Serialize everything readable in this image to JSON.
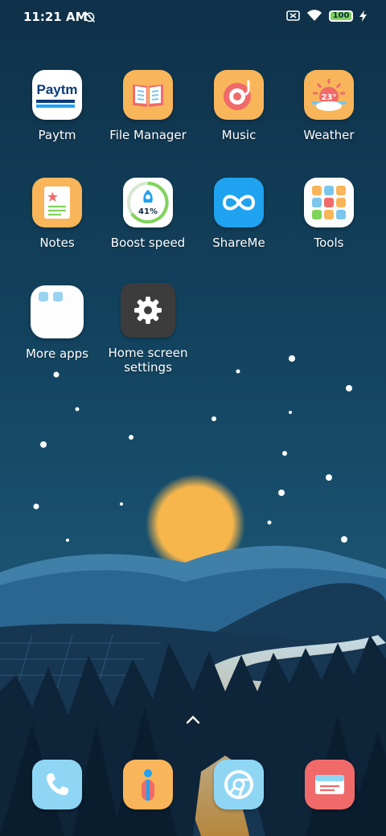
{
  "status_bar": {
    "time": "11:21 AM",
    "battery": "100",
    "icons": [
      "alarm-off-icon",
      "sim-off-icon",
      "wifi-icon",
      "battery-icon",
      "charging-icon"
    ]
  },
  "apps": [
    {
      "label": "Paytm",
      "icon": "paytm-icon",
      "logo_text": "Paytm"
    },
    {
      "label": "File Manager",
      "icon": "file-manager-icon"
    },
    {
      "label": "Music",
      "icon": "music-icon"
    },
    {
      "label": "Weather",
      "icon": "weather-icon",
      "temp": "23°"
    },
    {
      "label": "Notes",
      "icon": "notes-icon"
    },
    {
      "label": "Boost speed",
      "icon": "boost-speed-icon",
      "percent": "41%"
    },
    {
      "label": "ShareMe",
      "icon": "shareme-icon"
    },
    {
      "label": "Tools",
      "icon": "tools-folder-icon"
    },
    {
      "label": "More apps",
      "icon": "more-apps-folder-icon"
    },
    {
      "label": "Home screen settings",
      "icon": "gear-icon"
    }
  ],
  "dock": [
    {
      "name": "phone",
      "icon": "phone-icon",
      "color": "#8fd6f5"
    },
    {
      "name": "contacts",
      "icon": "contacts-icon",
      "color": "#f9b55a"
    },
    {
      "name": "browser",
      "icon": "chrome-icon",
      "color": "#8fd6f5"
    },
    {
      "name": "messages",
      "icon": "messages-icon",
      "color": "#f06a6a"
    }
  ],
  "colors": {
    "accent_orange": "#f9b55a",
    "accent_blue": "#1fa2f0",
    "sky_top": "#0f3149",
    "sun": "#f6b64c"
  }
}
